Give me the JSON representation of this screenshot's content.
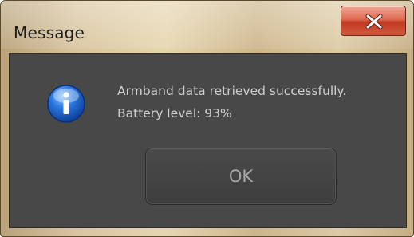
{
  "window": {
    "title": "Message"
  },
  "message": {
    "line1": "Armband data retrieved successfully.",
    "line2": "Battery level: 93%"
  },
  "buttons": {
    "ok_label": "OK"
  },
  "icons": {
    "close": "close-icon",
    "info": "info-icon"
  },
  "colors": {
    "dialog_background": "#484848",
    "message_text": "#cfcfcf",
    "close_button": "#d35a40",
    "info_icon": "#1f5fcf"
  }
}
